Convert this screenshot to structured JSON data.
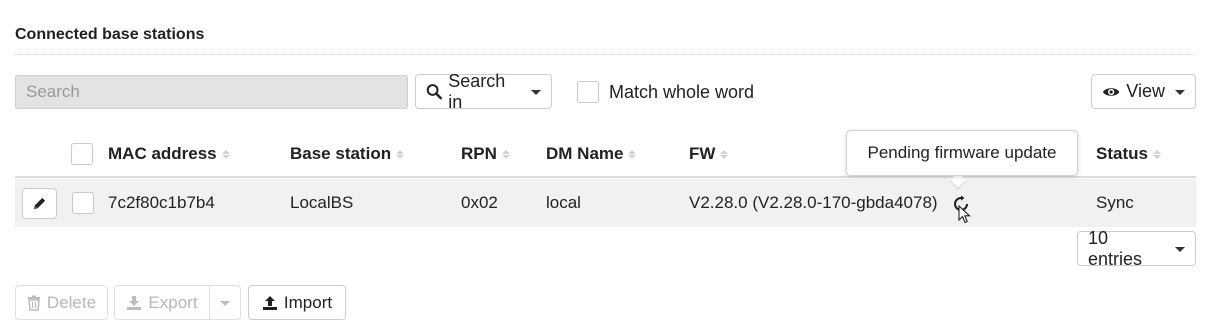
{
  "section": {
    "title": "Connected base stations"
  },
  "toolbar": {
    "search_placeholder": "Search",
    "search_value": "",
    "search_in_label": "Search in",
    "match_whole_word_label": "Match whole word",
    "view_label": "View"
  },
  "table": {
    "columns": [
      "MAC address",
      "Base station",
      "RPN",
      "DM Name",
      "FW",
      "Status"
    ],
    "rows": [
      {
        "mac": "7c2f80c1b7b4",
        "base_station": "LocalBS",
        "rpn": "0x02",
        "dm_name": "local",
        "fw": "V2.28.0 (V2.28.0-170-gbda4078)",
        "status": "Sync"
      }
    ]
  },
  "tooltip": {
    "text": "Pending firmware update"
  },
  "pagination": {
    "entries_label": "10 entries"
  },
  "actions": {
    "delete_label": "Delete",
    "export_label": "Export",
    "import_label": "Import"
  },
  "icons": {
    "search": "search-icon",
    "eye": "eye-icon",
    "pencil": "pencil-icon",
    "sync": "sync-icon",
    "trash": "trash-icon",
    "download": "download-icon",
    "upload": "upload-icon"
  }
}
